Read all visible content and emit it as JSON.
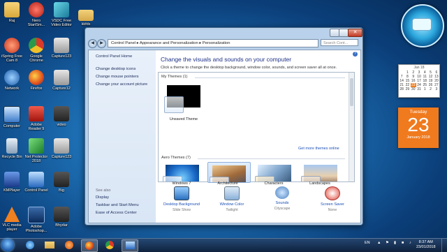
{
  "desktop_icons": [
    {
      "label": "Raj",
      "icon": "user-folder-icon",
      "color": "#f0c45a"
    },
    {
      "label": "Nero StartSm...",
      "icon": "nero-icon",
      "color": "#d0302a"
    },
    {
      "label": "VSDC Free Video Editor",
      "icon": "vsdc-icon",
      "color": "#2aa0c0"
    },
    {
      "label": "kkfds",
      "icon": "folder-icon",
      "color": "#e6c25a"
    },
    {
      "label": "iSpring Free Cam 8",
      "icon": "ispring-icon",
      "color": "#e04a2a"
    },
    {
      "label": "Google Chrome",
      "icon": "chrome-icon",
      "color": "#4a90d0"
    },
    {
      "label": "Capture123",
      "icon": "capture-icon",
      "color": "#888888"
    },
    {
      "label": "Network",
      "icon": "network-icon",
      "color": "#3a8ad0"
    },
    {
      "label": "Firefox",
      "icon": "firefox-icon",
      "color": "#e07a20"
    },
    {
      "label": "Capture12",
      "icon": "capture-icon",
      "color": "#888888"
    },
    {
      "label": "Computer",
      "icon": "computer-icon",
      "color": "#5aa0e0"
    },
    {
      "label": "Adobe Reader 9",
      "icon": "adobe-reader-icon",
      "color": "#c8201a"
    },
    {
      "label": "video",
      "icon": "video-file-icon",
      "color": "#444444"
    },
    {
      "label": "Recycle Bin",
      "icon": "recycle-bin-icon",
      "color": "#9ab0c8"
    },
    {
      "label": "Net Protector 2018",
      "icon": "net-protector-icon",
      "color": "#2a9a3a"
    },
    {
      "label": "Capture123",
      "icon": "capture-icon",
      "color": "#888888"
    },
    {
      "label": "KMPlayer",
      "icon": "kmplayer-icon",
      "color": "#3a6ad0"
    },
    {
      "label": "Control Panel",
      "icon": "control-panel-icon",
      "color": "#3a8ad0"
    },
    {
      "label": "Big",
      "icon": "file-icon",
      "color": "#444444"
    },
    {
      "label": "VLC media player",
      "icon": "vlc-icon",
      "color": "#f08020"
    },
    {
      "label": "Adobe Photoshop...",
      "icon": "photoshop-icon",
      "color": "#1a3a6a"
    },
    {
      "label": "Bhydar",
      "icon": "file-icon",
      "color": "#444444"
    }
  ],
  "gadgets": {
    "calendar_month": "Jan 18",
    "calendar_weeks": [
      [
        "",
        "1",
        "2",
        "3",
        "4",
        "5",
        "6"
      ],
      [
        "7",
        "8",
        "9",
        "10",
        "11",
        "12",
        "13"
      ],
      [
        "14",
        "15",
        "16",
        "17",
        "18",
        "19",
        "20"
      ],
      [
        "21",
        "22",
        "23",
        "24",
        "25",
        "26",
        "27"
      ],
      [
        "28",
        "29",
        "30",
        "31",
        "1",
        "2",
        "3"
      ]
    ],
    "today": "23",
    "date_weekday": "Tuesday",
    "date_day": "23",
    "date_month_year": "January 2018",
    "accent": "#f07a1e"
  },
  "window": {
    "address": "Control Panel ▸ Appearance and Personalization ▸ Personalization",
    "search_placeholder": "Search Cont...",
    "close_glyph": "✕",
    "left_nav": {
      "home": "Control Panel Home",
      "links": [
        "Change desktop icons",
        "Change mouse pointers",
        "Change your account picture"
      ],
      "see_also_heading": "See also",
      "see_also": [
        "Display",
        "Taskbar and Start Menu",
        "Ease of Access Center"
      ]
    },
    "heading": "Change the visuals and sounds on your computer",
    "subheading": "Click a theme to change the desktop background, window color, sounds, and screen saver all at once.",
    "my_themes_label": "My Themes (1)",
    "aero_themes_label": "Aero Themes (7)",
    "get_more": "Get more themes online",
    "my_themes": [
      {
        "name": "Unsaved Theme"
      }
    ],
    "aero_themes": [
      {
        "name": "Windows 7"
      },
      {
        "name": "Architecture",
        "selected": true
      },
      {
        "name": "Characters"
      },
      {
        "name": "Landscapes"
      }
    ],
    "options": [
      {
        "label": "Desktop Background",
        "value": "Slide Show",
        "icon": "desktop-background-icon"
      },
      {
        "label": "Window Color",
        "value": "Twilight",
        "icon": "window-color-icon"
      },
      {
        "label": "Sounds",
        "value": "Cityscape",
        "icon": "sounds-icon"
      },
      {
        "label": "Screen Saver",
        "value": "None",
        "icon": "screen-saver-icon"
      }
    ]
  },
  "taskbar": {
    "language": "EN",
    "time": "8:37 AM",
    "date": "23/01/2018",
    "pinned": [
      "internet-explorer-icon",
      "file-explorer-icon",
      "media-player-icon",
      "firefox-icon",
      "chrome-icon",
      "control-panel-icon"
    ]
  }
}
